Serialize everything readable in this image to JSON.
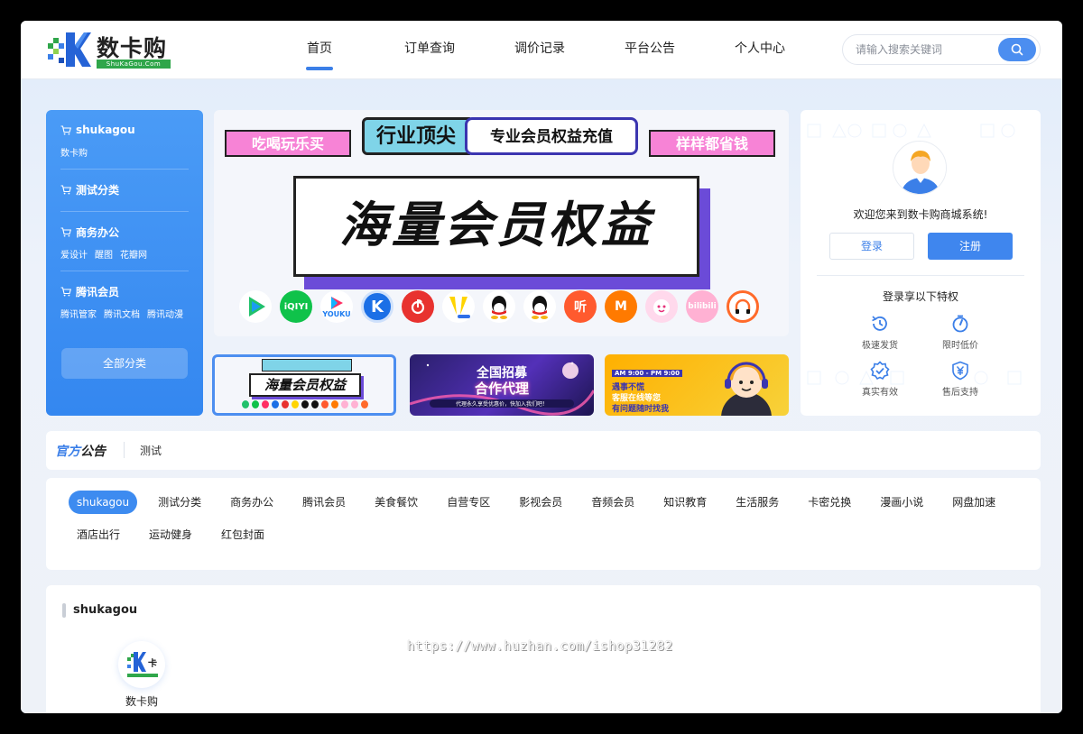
{
  "brand": {
    "name": "数卡购",
    "sub": "ShuKaGou.Com"
  },
  "nav": [
    {
      "label": "首页",
      "active": true
    },
    {
      "label": "订单查询"
    },
    {
      "label": "调价记录"
    },
    {
      "label": "平台公告"
    },
    {
      "label": "个人中心"
    }
  ],
  "search": {
    "placeholder": "请输入搜索关键词",
    "value": ""
  },
  "categories": {
    "groups": [
      {
        "title": "shukagou",
        "links": [
          "数卡购"
        ]
      },
      {
        "title": "测试分类",
        "links": []
      },
      {
        "title": "商务办公",
        "links": [
          "爱设计",
          "醒图",
          "花瓣网"
        ]
      },
      {
        "title": "腾讯会员",
        "links": [
          "腾讯管家",
          "腾讯文档",
          "腾讯动漫"
        ]
      }
    ],
    "all_label": "全部分类"
  },
  "banner": {
    "tag_left": "吃喝玩乐买",
    "tag_center_a": "行业顶尖",
    "tag_center_b": "专业会员权益充值",
    "tag_right": "样样都省钱",
    "headline": "海量会员权益",
    "apps": [
      "腾讯视频",
      "iQIYI",
      "YOUKU",
      "酷我",
      "网易云",
      "优酷",
      "QQ",
      "QQ",
      "听书",
      "芒果",
      "饿了么",
      "bilibili",
      "喜马拉雅"
    ]
  },
  "thumbs": [
    {
      "headline": "海量会员权益"
    },
    {
      "title": "全国招募",
      "subtitle": "合作代理",
      "note": "代理永久享受优惠价，快加入我们吧！"
    },
    {
      "time": "AM 9:00 - PM 9:00",
      "line1": "遇事不慌",
      "line2": "客服在线等您",
      "line3": "有问题随时找我"
    }
  ],
  "user": {
    "welcome": "欢迎您来到数卡购商城系统!",
    "login": "登录",
    "register": "注册",
    "perk_title": "登录享以下特权",
    "perks": [
      {
        "label": "极速发货",
        "icon": "clock-icon"
      },
      {
        "label": "限时低价",
        "icon": "timer-icon"
      },
      {
        "label": "真实有效",
        "icon": "verified-icon"
      },
      {
        "label": "售后支持",
        "icon": "shield-yen-icon"
      }
    ]
  },
  "notice": {
    "label_a": "官方",
    "label_b": "公告",
    "text": "测试"
  },
  "tabs": [
    "shukagou",
    "测试分类",
    "商务办公",
    "腾讯会员",
    "美食餐饮",
    "自营专区",
    "影视会员",
    "音频会员",
    "知识教育",
    "生活服务",
    "卡密兑换",
    "漫画小说",
    "网盘加速",
    "酒店出行",
    "运动健身",
    "红包封面"
  ],
  "section": {
    "title": "shukagou"
  },
  "products": [
    {
      "name": "数卡购"
    }
  ],
  "watermark": "https://www.huzhan.com/ishop31282",
  "colors": {
    "accent": "#3b7fe8",
    "panel": "#4a9bf6",
    "pink": "#f783d6",
    "purple": "#6b4bd8"
  }
}
